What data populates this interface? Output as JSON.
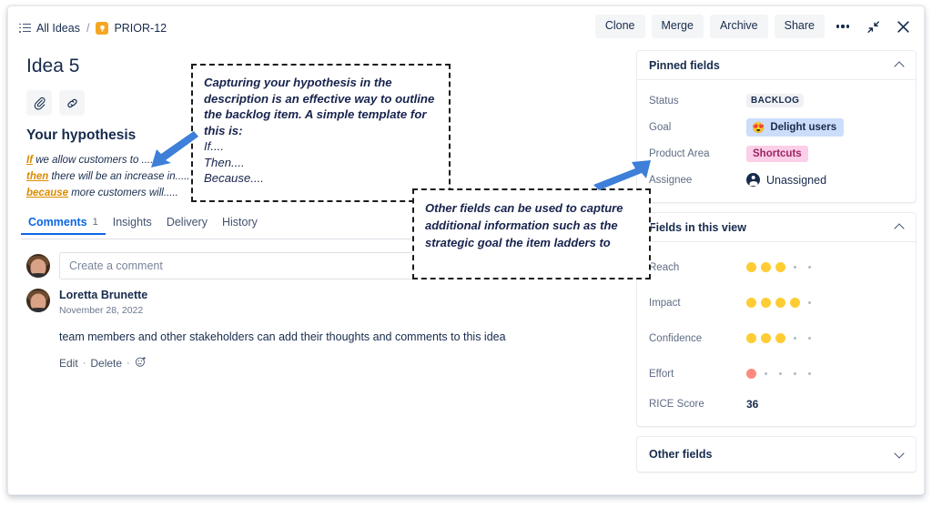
{
  "breadcrumb": {
    "list_icon": "list-icon",
    "all_ideas": "All Ideas",
    "separator": "/",
    "idea_icon": "lightbulb-icon",
    "key": "PRIOR-12"
  },
  "toolbar": {
    "clone": "Clone",
    "merge": "Merge",
    "archive": "Archive",
    "share": "Share",
    "more_icon": "more-options-icon",
    "collapse_icon": "collapse-icon",
    "close_icon": "close-icon"
  },
  "idea": {
    "title": "Idea 5",
    "attach_icon": "paperclip-icon",
    "link_icon": "link-icon",
    "hypothesis_heading": "Your hypothesis",
    "hypothesis": [
      {
        "keyword": "If",
        "rest": " we allow customers to ......"
      },
      {
        "keyword": "then",
        "rest": " there will be an increase in....."
      },
      {
        "keyword": "because",
        "rest": " more customers will....."
      }
    ]
  },
  "tabs": [
    {
      "label": "Comments",
      "count": "1",
      "active": true
    },
    {
      "label": "Insights",
      "count": "",
      "active": false
    },
    {
      "label": "Delivery",
      "count": "",
      "active": false
    },
    {
      "label": "History",
      "count": "",
      "active": false
    }
  ],
  "composer": {
    "placeholder": "Create a comment",
    "avatar": "user-avatar"
  },
  "comment": {
    "author": "Loretta Brunette",
    "date": "November 28, 2022",
    "body": "team members and other stakeholders can add their thoughts and comments to this idea",
    "edit": "Edit",
    "delete": "Delete",
    "sep": "·",
    "emoji_icon": "add-reaction-icon"
  },
  "sidebar": {
    "pinned": {
      "title": "Pinned fields",
      "collapse_icon": "chevron-up-icon",
      "fields": [
        {
          "label": "Status",
          "value": "BACKLOG",
          "type": "status-badge"
        },
        {
          "label": "Goal",
          "value": "Delight users",
          "type": "goal-chip",
          "emoji": "😍"
        },
        {
          "label": "Product Area",
          "value": "Shortcuts",
          "type": "area-chip"
        },
        {
          "label": "Assignee",
          "value": "Unassigned",
          "type": "assignee",
          "icon": "person-icon"
        }
      ]
    },
    "fields_view": {
      "title": "Fields in this view",
      "collapse_icon": "chevron-up-icon",
      "rice": [
        {
          "label": "Reach",
          "filled": 3,
          "total": 5,
          "color": "#ffcc33"
        },
        {
          "label": "Impact",
          "filled": 4,
          "total": 5,
          "color": "#ffcc33"
        },
        {
          "label": "Confidence",
          "filled": 3,
          "total": 5,
          "color": "#ffcc33"
        },
        {
          "label": "Effort",
          "filled": 1,
          "total": 5,
          "color": "#ff8a80"
        }
      ],
      "score_label": "RICE Score",
      "score_value": "36"
    },
    "other": {
      "title": "Other fields",
      "expand_icon": "chevron-down-icon"
    }
  },
  "annotations": {
    "callout1": {
      "lead": "Capturing your hypothesis in the description is an effective way to outline the backlog item. A simple template for this is:",
      "line_if": "If....",
      "line_then": "Then....",
      "line_because": "Because...."
    },
    "callout2": {
      "text": "Other fields can be used to capture additional information such as the strategic goal the item ladders to"
    },
    "arrow_left": "arrow-pointing-to-hypothesis",
    "arrow_right": "arrow-pointing-to-pinned-fields"
  },
  "colors": {
    "accent": "#0c66e4",
    "keyword": "#d98c00",
    "rice_on": "#ffcc33",
    "effort_on": "#ff8a80",
    "idea_icon_bg": "#f5a623"
  }
}
